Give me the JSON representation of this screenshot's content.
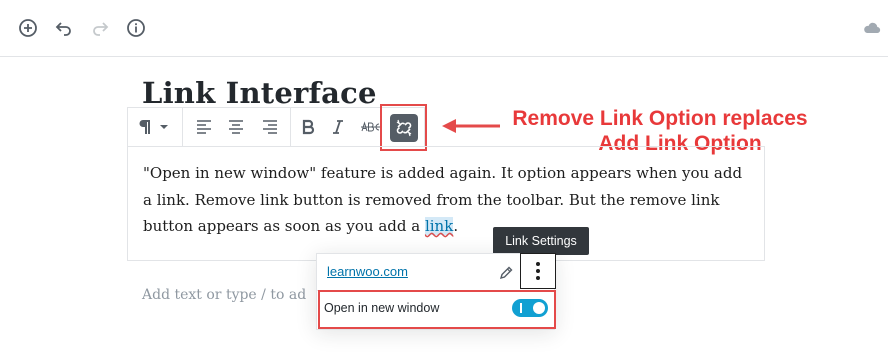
{
  "editor": {
    "title": "Link Interface",
    "paragraph_before_link": "\"Open in new window\" feature is added again. It option appears when you add a link. Remove link button is removed from the toolbar. But the remove link button appears as soon as you add a ",
    "link_text": "link",
    "paragraph_after_link": ".",
    "placeholder": "Add text or type / to ad"
  },
  "annotation": {
    "line1": "Remove Link Option replaces",
    "line2": "Add Link Option",
    "color": "#e8393a"
  },
  "link_popover": {
    "tooltip": "Link Settings",
    "url": "learnwoo.com",
    "open_in_new_window_label": "Open in new window",
    "open_in_new_window_enabled": true
  },
  "icons": {
    "top_bar": [
      "add-block-icon",
      "undo-icon",
      "redo-icon",
      "info-icon",
      "cloud-icon"
    ],
    "block_toolbar": [
      "paragraph-icon",
      "chevron-down-icon",
      "align-left-icon",
      "align-center-icon",
      "align-right-icon",
      "bold-icon",
      "italic-icon",
      "strikethrough-icon",
      "unlink-icon"
    ]
  },
  "colors": {
    "accent": "#0073aa",
    "toggle": "#11a0d2",
    "highlight_box": "#e44a4a"
  }
}
